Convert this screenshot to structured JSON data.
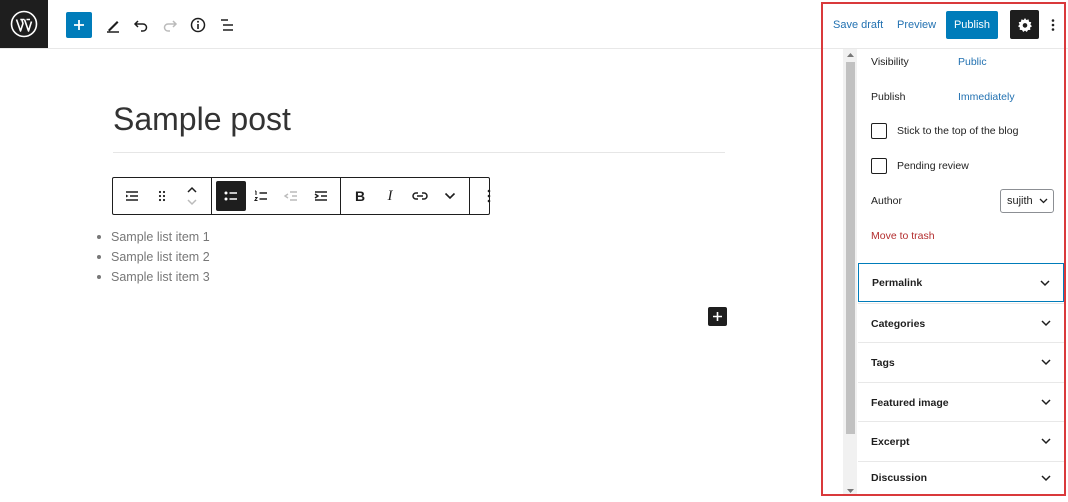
{
  "toolbar": {
    "add_block_label": "Add block",
    "tools_label": "Tools",
    "undo_label": "Undo",
    "redo_label": "Redo",
    "details_label": "Details",
    "outline_label": "List view"
  },
  "header": {
    "save_draft": "Save draft",
    "preview": "Preview",
    "publish": "Publish"
  },
  "editor": {
    "title": "Sample post",
    "list_items": [
      "Sample list item 1",
      "Sample list item 2",
      "Sample list item 3"
    ]
  },
  "sidebar": {
    "visibility_label": "Visibility",
    "visibility_value": "Public",
    "publish_label": "Publish",
    "publish_value": "Immediately",
    "sticky_label": "Stick to the top of the blog",
    "pending_label": "Pending review",
    "author_label": "Author",
    "author_value": "sujith",
    "trash_label": "Move to trash",
    "panels": [
      "Permalink",
      "Categories",
      "Tags",
      "Featured image",
      "Excerpt",
      "Discussion"
    ]
  },
  "colors": {
    "accent": "#007cba",
    "link": "#2271b1",
    "danger": "#b32d2e",
    "highlight": "#d9393b"
  }
}
